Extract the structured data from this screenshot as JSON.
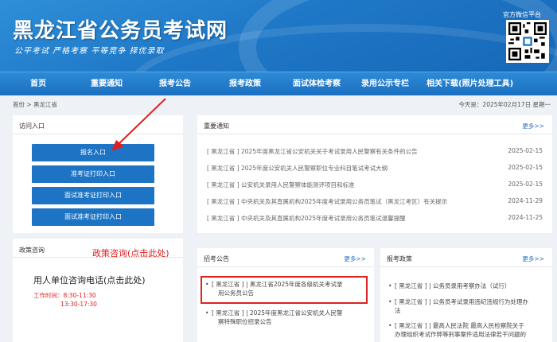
{
  "header": {
    "site_title": "黑龙江省公务员考试网",
    "slogan": "公平考试 严格考察 平等竞争 择优录取",
    "wechat_label": "官方微信平台"
  },
  "nav": {
    "items": [
      "首页",
      "重要通知",
      "报考公告",
      "报考政策",
      "面试体检考察",
      "录用公示专栏",
      "相关下载(照片处理工具)"
    ]
  },
  "breadcrumb": "首份 > 黑龙江省",
  "today": "今天是：2025年02月17日  星期一",
  "access": {
    "title": "访问入口",
    "buttons": [
      "报名入口",
      "准考证打印入口",
      "面试准考证打印入口",
      "面试准考证打印入口"
    ]
  },
  "notices": {
    "title": "重要通知",
    "more": "更多>>",
    "rows": [
      {
        "title": "[ 黑龙江省 ] 2025年度黑龙江省公安机关关于考试录用人民警察有关条件的公告",
        "date": "2025-02-15"
      },
      {
        "title": "[ 黑龙江省 ] 2025年度公安机关人民警察职位专业科目笔试考试大纲",
        "date": "2025-02-15"
      },
      {
        "title": "[ 黑龙江省 ] 公安机关录用人民警察体能测评项目和标准",
        "date": "2025-02-15"
      },
      {
        "title": "[ 黑龙江省 ] 中央机关及其直属机构2025年度考试录用公务员笔试（黑龙江考区）有关提示",
        "date": "2024-11-29"
      },
      {
        "title": "[ 黑龙江省 ] 中央机关及其直属机构2025年度考试录用公务员笔试温馨提醒",
        "date": "2024-11-25"
      }
    ]
  },
  "policy_consult": {
    "title": "政策咨询",
    "link": "政策咨询(点击此处)",
    "consult_title": "用人单位咨询电话(点击此处)",
    "worktime_label": "工作时间：8:30-11:30",
    "worktime_pm": "13:30-17:30"
  },
  "recruit": {
    "title": "招考公告",
    "more": "更多>>",
    "items": [
      {
        "line1": "[ 黑龙江省 ] | 黑龙江省2025年度各级机关考试录",
        "line2": "用公务员公告"
      },
      {
        "line1": "[ 黑龙江省 ] | 2025年度黑龙江省公安机关人民警",
        "line2": "察特殊职位招录公告"
      }
    ]
  },
  "policy": {
    "title": "报考政策",
    "more": "更多>>",
    "items": [
      {
        "line1": "[ 黑龙江省 ] | 公务员录用考察办法（试行）",
        "line2": ""
      },
      {
        "line1": "[ 黑龙江省 ] | 公务员考试录用违纪违规行为处理办",
        "line2": "法"
      },
      {
        "line1": "[ 黑龙江省 ] | 最高人民法院 最高人民检察院关于",
        "line2": "办理组织考试作弊等刑事案件适用法律若干问题的"
      }
    ]
  },
  "colors": {
    "brand_blue": "#1d74c5",
    "accent_red": "#e02020"
  }
}
